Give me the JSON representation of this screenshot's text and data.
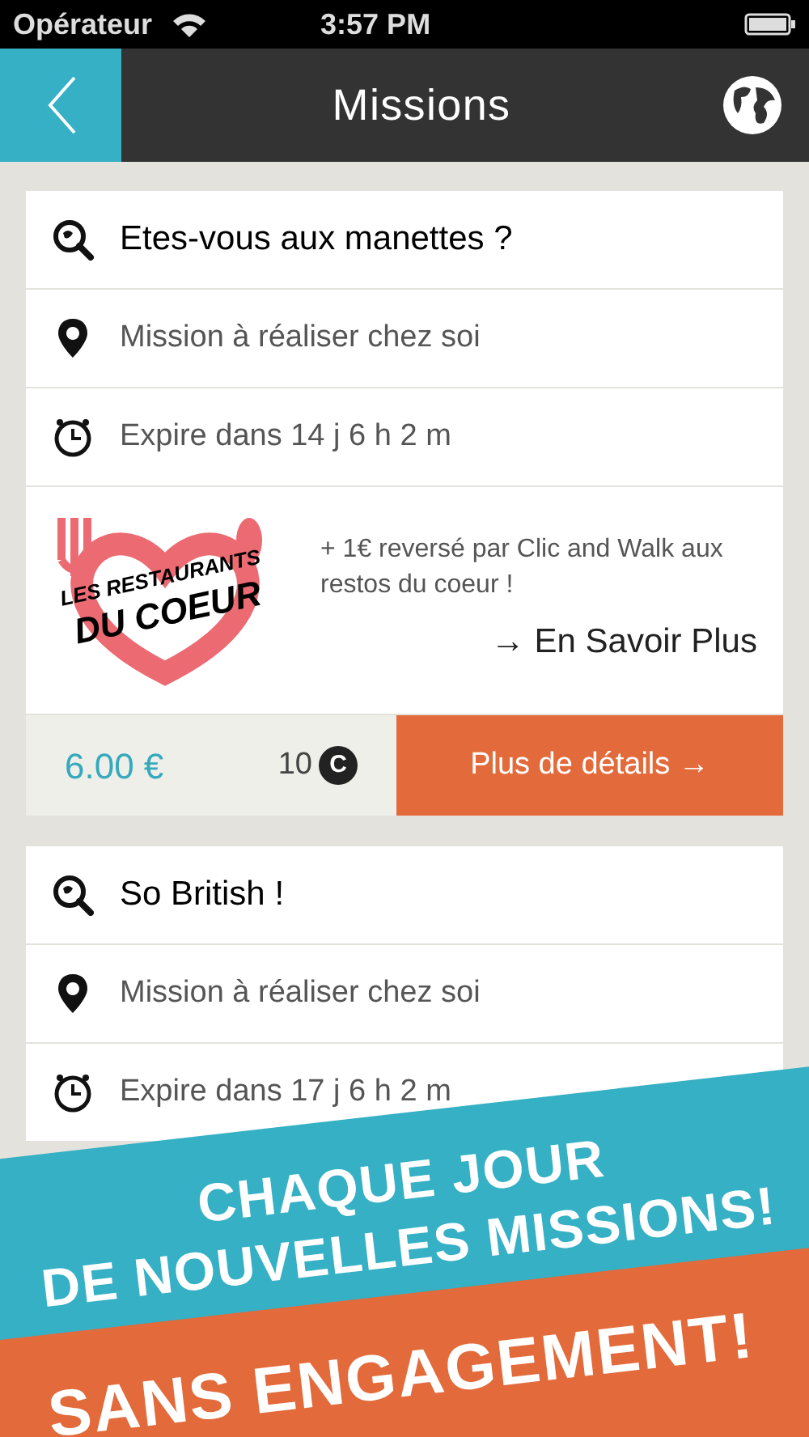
{
  "status_bar": {
    "carrier": "Opérateur",
    "time": "3:57 PM"
  },
  "nav": {
    "title": "Missions"
  },
  "missions": [
    {
      "title": "Etes-vous aux manettes ?",
      "location": "Mission à réaliser chez soi",
      "expiry": "Expire dans 14 j 6 h 2 m",
      "promo": {
        "logo_top": "LES RESTAURANTS",
        "logo_bottom": "DU COEUR",
        "text": "+ 1€ reversé par Clic and Walk aux restos du coeur !",
        "link": "→  En Savoir Plus"
      },
      "footer": {
        "price": "6.00 €",
        "coins": "10",
        "coin_symbol": "C",
        "button": "Plus de détails →"
      }
    },
    {
      "title": "So British !",
      "location": "Mission à réaliser chez soi",
      "expiry": "Expire dans 17 j 6 h 2 m"
    }
  ],
  "banners": [
    {
      "lines": [
        "CHAQUE JOUR",
        "DE NOUVELLES MISSIONS!"
      ],
      "color": "#35b0c4"
    },
    {
      "lines": [
        "SANS ENGAGEMENT!"
      ],
      "color": "#e36a3b"
    }
  ]
}
